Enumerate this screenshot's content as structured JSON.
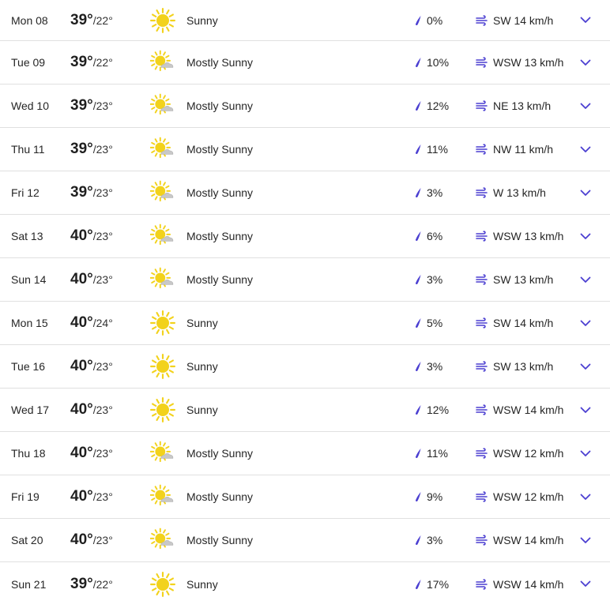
{
  "colors": {
    "accent": "#4b3fd1",
    "sun": "#f2d21c",
    "cloud": "#c8c8c8",
    "divider": "#e0e0e0"
  },
  "days": [
    {
      "day": "Mon 08",
      "high": "39°",
      "low": "/22°",
      "icon": "sunny-icon",
      "condition": "Sunny",
      "precip": "0%",
      "wind": "SW 14 km/h"
    },
    {
      "day": "Tue 09",
      "high": "39°",
      "low": "/22°",
      "icon": "mostly-sunny-icon",
      "condition": "Mostly Sunny",
      "precip": "10%",
      "wind": "WSW 13 km/h"
    },
    {
      "day": "Wed 10",
      "high": "39°",
      "low": "/23°",
      "icon": "mostly-sunny-icon",
      "condition": "Mostly Sunny",
      "precip": "12%",
      "wind": "NE 13 km/h"
    },
    {
      "day": "Thu 11",
      "high": "39°",
      "low": "/23°",
      "icon": "mostly-sunny-icon",
      "condition": "Mostly Sunny",
      "precip": "11%",
      "wind": "NW 11 km/h"
    },
    {
      "day": "Fri 12",
      "high": "39°",
      "low": "/23°",
      "icon": "mostly-sunny-icon",
      "condition": "Mostly Sunny",
      "precip": "3%",
      "wind": "W 13 km/h"
    },
    {
      "day": "Sat 13",
      "high": "40°",
      "low": "/23°",
      "icon": "mostly-sunny-icon",
      "condition": "Mostly Sunny",
      "precip": "6%",
      "wind": "WSW 13 km/h"
    },
    {
      "day": "Sun 14",
      "high": "40°",
      "low": "/23°",
      "icon": "mostly-sunny-icon",
      "condition": "Mostly Sunny",
      "precip": "3%",
      "wind": "SW 13 km/h"
    },
    {
      "day": "Mon 15",
      "high": "40°",
      "low": "/24°",
      "icon": "sunny-icon",
      "condition": "Sunny",
      "precip": "5%",
      "wind": "SW 14 km/h"
    },
    {
      "day": "Tue 16",
      "high": "40°",
      "low": "/23°",
      "icon": "sunny-icon",
      "condition": "Sunny",
      "precip": "3%",
      "wind": "SW 13 km/h"
    },
    {
      "day": "Wed 17",
      "high": "40°",
      "low": "/23°",
      "icon": "sunny-icon",
      "condition": "Sunny",
      "precip": "12%",
      "wind": "WSW 14 km/h"
    },
    {
      "day": "Thu 18",
      "high": "40°",
      "low": "/23°",
      "icon": "mostly-sunny-icon",
      "condition": "Mostly Sunny",
      "precip": "11%",
      "wind": "WSW 12 km/h"
    },
    {
      "day": "Fri 19",
      "high": "40°",
      "low": "/23°",
      "icon": "mostly-sunny-icon",
      "condition": "Mostly Sunny",
      "precip": "9%",
      "wind": "WSW 12 km/h"
    },
    {
      "day": "Sat 20",
      "high": "40°",
      "low": "/23°",
      "icon": "mostly-sunny-icon",
      "condition": "Mostly Sunny",
      "precip": "3%",
      "wind": "WSW 14 km/h"
    },
    {
      "day": "Sun 21",
      "high": "39°",
      "low": "/22°",
      "icon": "sunny-icon",
      "condition": "Sunny",
      "precip": "17%",
      "wind": "WSW 14 km/h"
    }
  ]
}
